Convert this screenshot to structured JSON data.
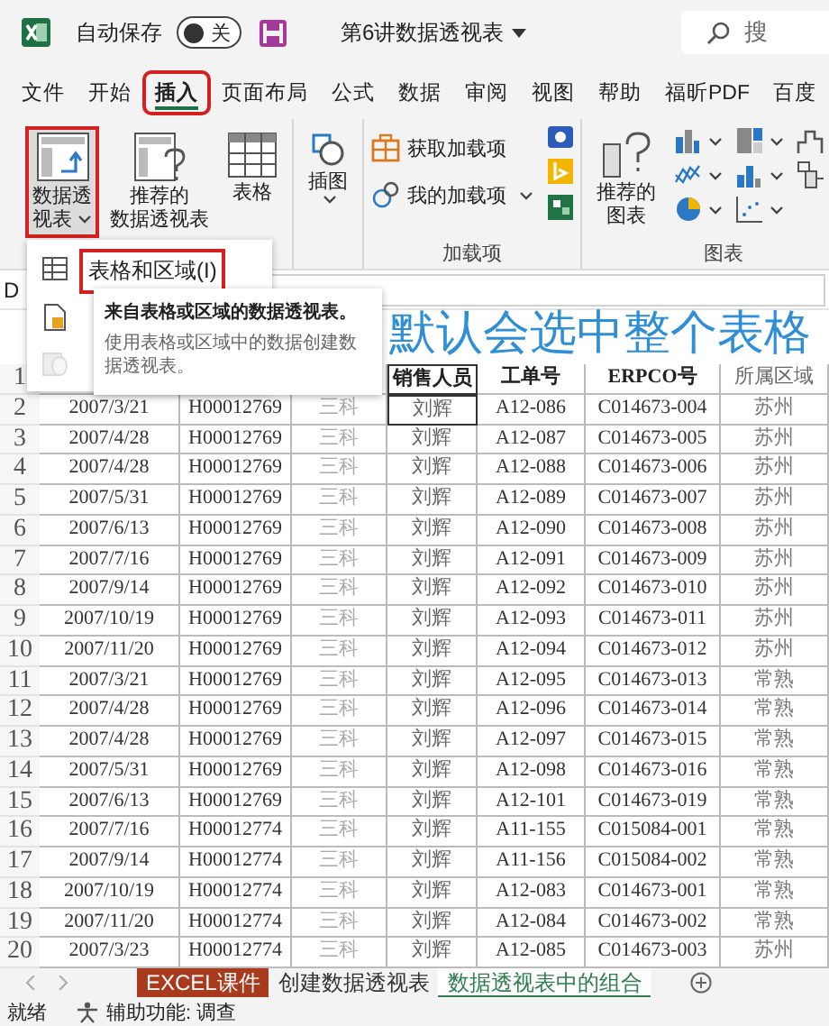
{
  "title_bar": {
    "autosave_label": "自动保存",
    "autosave_toggle": {
      "label": "关",
      "on": false
    },
    "document_title": "第6讲数据透视表",
    "search_placeholder": "搜"
  },
  "ribbon_tabs": [
    {
      "label": "文件",
      "selected": false,
      "highlighted": false
    },
    {
      "label": "开始",
      "selected": false,
      "highlighted": false
    },
    {
      "label": "插入",
      "selected": true,
      "highlighted": true
    },
    {
      "label": "页面布局",
      "selected": false,
      "highlighted": false
    },
    {
      "label": "公式",
      "selected": false,
      "highlighted": false
    },
    {
      "label": "数据",
      "selected": false,
      "highlighted": false
    },
    {
      "label": "审阅",
      "selected": false,
      "highlighted": false
    },
    {
      "label": "视图",
      "selected": false,
      "highlighted": false
    },
    {
      "label": "帮助",
      "selected": false,
      "highlighted": false
    },
    {
      "label": "福昕PDF",
      "selected": false,
      "highlighted": false
    },
    {
      "label": "百度",
      "selected": false,
      "highlighted": false
    }
  ],
  "ribbon_groups": [
    {
      "buttons": [
        {
          "kind": "large",
          "lines": [
            "数据透",
            "视表"
          ],
          "dropdown": true,
          "highlighted": true,
          "pressed": true
        },
        {
          "kind": "large",
          "lines": [
            "推荐的",
            "数据透视表"
          ],
          "dropdown": false,
          "highlighted": false,
          "pressed": false
        },
        {
          "kind": "large",
          "lines": [
            "表格"
          ],
          "dropdown": false,
          "highlighted": false,
          "pressed": false
        }
      ]
    },
    {
      "buttons": [
        {
          "kind": "large",
          "lines": [
            "插图"
          ],
          "dropdown": true,
          "highlighted": false,
          "pressed": false
        }
      ]
    },
    {
      "label": "加载项",
      "buttons": [
        {
          "kind": "small",
          "lines": [
            "获取加载项"
          ],
          "dropdown": false
        },
        {
          "kind": "small",
          "lines": [
            "我的加载项"
          ],
          "dropdown": true
        },
        {
          "kind": "app-stack"
        }
      ]
    },
    {
      "label": "图表",
      "buttons": [
        {
          "kind": "large",
          "lines": [
            "推荐的",
            "图表"
          ],
          "dropdown": false,
          "highlighted": false,
          "pressed": false
        },
        {
          "kind": "chart-grid"
        }
      ]
    }
  ],
  "pivot_menu": {
    "items": [
      {
        "label": "表格和区域(I)",
        "highlighted": true,
        "disabled": false
      },
      {
        "disabled": false
      },
      {
        "disabled": true
      }
    ]
  },
  "tooltip": {
    "title": "来自表格或区域的数据透视表。",
    "description": "使用表格或区域中的数据创建数据透视表。"
  },
  "formula_bar": {
    "name_box": "D"
  },
  "annotation": "默认会选中整个表格",
  "sheet": {
    "header_row": {
      "row_number": "1",
      "visible_cells": [
        "销售人员",
        "工单号",
        "ERPCO号",
        "所属区域"
      ]
    },
    "rows": [
      {
        "row_number": "2",
        "cells": [
          "2007/3/21",
          "H00012769",
          "三科",
          "刘辉",
          "A12-086",
          "C014673-004",
          "苏州"
        ]
      },
      {
        "row_number": "3",
        "cells": [
          "2007/4/28",
          "H00012769",
          "三科",
          "刘辉",
          "A12-087",
          "C014673-005",
          "苏州"
        ]
      },
      {
        "row_number": "4",
        "cells": [
          "2007/4/28",
          "H00012769",
          "三科",
          "刘辉",
          "A12-088",
          "C014673-006",
          "苏州"
        ]
      },
      {
        "row_number": "5",
        "cells": [
          "2007/5/31",
          "H00012769",
          "三科",
          "刘辉",
          "A12-089",
          "C014673-007",
          "苏州"
        ]
      },
      {
        "row_number": "6",
        "cells": [
          "2007/6/13",
          "H00012769",
          "三科",
          "刘辉",
          "A12-090",
          "C014673-008",
          "苏州"
        ]
      },
      {
        "row_number": "7",
        "cells": [
          "2007/7/16",
          "H00012769",
          "三科",
          "刘辉",
          "A12-091",
          "C014673-009",
          "苏州"
        ]
      },
      {
        "row_number": "8",
        "cells": [
          "2007/9/14",
          "H00012769",
          "三科",
          "刘辉",
          "A12-092",
          "C014673-010",
          "苏州"
        ]
      },
      {
        "row_number": "9",
        "cells": [
          "2007/10/19",
          "H00012769",
          "三科",
          "刘辉",
          "A12-093",
          "C014673-011",
          "苏州"
        ]
      },
      {
        "row_number": "10",
        "cells": [
          "2007/11/20",
          "H00012769",
          "三科",
          "刘辉",
          "A12-094",
          "C014673-012",
          "苏州"
        ]
      },
      {
        "row_number": "11",
        "cells": [
          "2007/3/21",
          "H00012769",
          "三科",
          "刘辉",
          "A12-095",
          "C014673-013",
          "常熟"
        ]
      },
      {
        "row_number": "12",
        "cells": [
          "2007/4/28",
          "H00012769",
          "三科",
          "刘辉",
          "A12-096",
          "C014673-014",
          "常熟"
        ]
      },
      {
        "row_number": "13",
        "cells": [
          "2007/4/28",
          "H00012769",
          "三科",
          "刘辉",
          "A12-097",
          "C014673-015",
          "常熟"
        ]
      },
      {
        "row_number": "14",
        "cells": [
          "2007/5/31",
          "H00012769",
          "三科",
          "刘辉",
          "A12-098",
          "C014673-016",
          "常熟"
        ]
      },
      {
        "row_number": "15",
        "cells": [
          "2007/6/13",
          "H00012769",
          "三科",
          "刘辉",
          "A12-101",
          "C014673-019",
          "常熟"
        ]
      },
      {
        "row_number": "16",
        "cells": [
          "2007/7/16",
          "H00012774",
          "三科",
          "刘辉",
          "A11-155",
          "C015084-001",
          "常熟"
        ]
      },
      {
        "row_number": "17",
        "cells": [
          "2007/9/14",
          "H00012774",
          "三科",
          "刘辉",
          "A11-156",
          "C015084-002",
          "常熟"
        ]
      },
      {
        "row_number": "18",
        "cells": [
          "2007/10/19",
          "H00012774",
          "三科",
          "刘辉",
          "A12-083",
          "C014673-001",
          "常熟"
        ]
      },
      {
        "row_number": "19",
        "cells": [
          "2007/11/20",
          "H00012774",
          "三科",
          "刘辉",
          "A12-084",
          "C014673-002",
          "常熟"
        ]
      },
      {
        "row_number": "20",
        "cells": [
          "2007/3/23",
          "H00012774",
          "三科",
          "刘辉",
          "A12-085",
          "C014673-003",
          "苏州"
        ]
      }
    ]
  },
  "sheet_tabs": [
    {
      "label": "EXCEL课件",
      "selected": false,
      "color": "#a83a1e"
    },
    {
      "label": "创建数据透视表",
      "selected": false
    },
    {
      "label": "数据透视表中的组合",
      "selected": true
    }
  ],
  "status_bar": {
    "status": "就绪",
    "accessibility": "辅助功能: 调查"
  }
}
